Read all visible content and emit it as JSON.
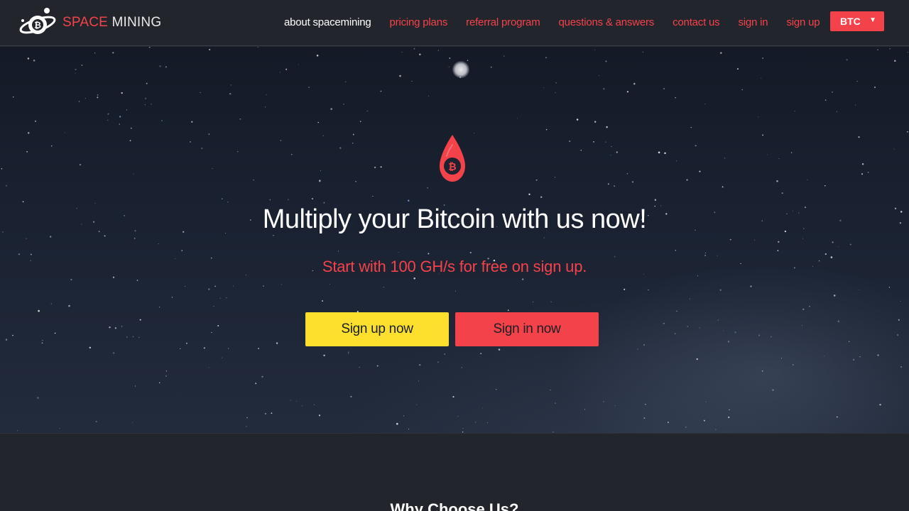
{
  "brand": {
    "name_part1": "SPACE",
    "name_part2": "MINING",
    "accent_color": "#f4424b",
    "logo_icon": "planet-bitcoin-icon"
  },
  "nav": {
    "items": [
      {
        "label": "about spacemining",
        "active": true
      },
      {
        "label": "pricing plans",
        "active": false
      },
      {
        "label": "referral program",
        "active": false
      },
      {
        "label": "questions & answers",
        "active": false
      },
      {
        "label": "contact us",
        "active": false
      },
      {
        "label": "sign in",
        "active": false
      },
      {
        "label": "sign up",
        "active": false
      }
    ],
    "currency": {
      "selected": "BTC",
      "arrow": "▼"
    }
  },
  "hero": {
    "icon": "bitcoin-drop-icon",
    "headline": "Multiply your Bitcoin with us now!",
    "subline": "Start with 100 GH/s for free on sign up.",
    "signup_label": "Sign up now",
    "signin_label": "Sign in now",
    "signup_color": "#fde02e",
    "signin_color": "#f4424b"
  },
  "section": {
    "why_title": "Why Choose Us?"
  }
}
